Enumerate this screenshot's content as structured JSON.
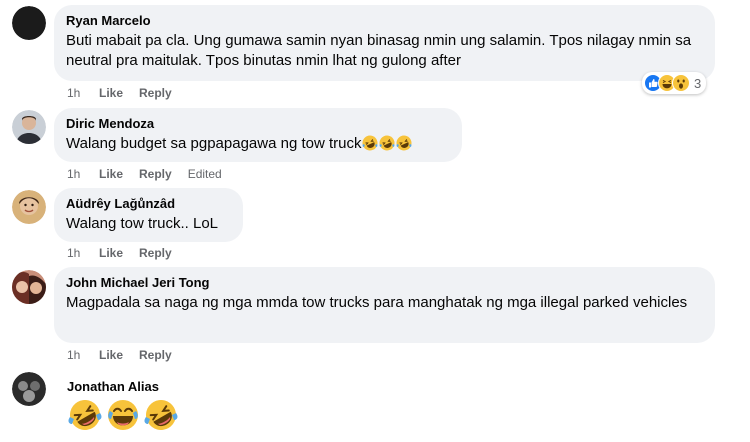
{
  "comments": [
    {
      "author": "Ryan Marcelo",
      "text": "Buti mabait pa cla. Ung gumawa samin nyan binasag nmin ung salamin. Tpos nilagay nmin sa neutral pra maitulak. Tpos binutas nmin lhat ng gulong after",
      "time": "1h",
      "like": "Like",
      "reply": "Reply",
      "reaction_count": "3",
      "reaction_icons": [
        "like-icon",
        "haha-icon",
        "wow-icon"
      ]
    },
    {
      "author": "Diric Mendoza",
      "text": "Walang budget sa pgpapagawa ng tow truck",
      "emojis": [
        "rofl-emoji",
        "rofl-emoji",
        "rofl-emoji"
      ],
      "time": "1h",
      "like": "Like",
      "reply": "Reply",
      "edited": "Edited"
    },
    {
      "author": "Aüdrêy Lağůnzâd",
      "text": "Walang tow truck.. LoL",
      "time": "1h",
      "like": "Like",
      "reply": "Reply"
    },
    {
      "author": "John Michael Jeri Tong",
      "text": "Magpadala sa naga ng mga mmda tow trucks para manghatak ng mga illegal parked vehicles",
      "time": "1h",
      "like": "Like",
      "reply": "Reply"
    },
    {
      "author": "Jonathan Alias",
      "emojis": [
        "rofl-emoji",
        "joy-emoji",
        "rofl-emoji"
      ]
    }
  ],
  "colors": {
    "bubble": "#f0f2f5",
    "meta": "#65676b",
    "like_blue": "#1877f2",
    "emoji_yellow": "#f7c33b"
  }
}
